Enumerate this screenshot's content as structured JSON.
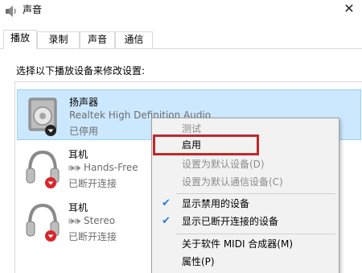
{
  "window": {
    "title": "声音",
    "close_label": "✕"
  },
  "tabs": [
    {
      "label": "播放"
    },
    {
      "label": "录制"
    },
    {
      "label": "声音"
    },
    {
      "label": "通信"
    }
  ],
  "prompt": "选择以下播放设备来修改设置:",
  "devices": [
    {
      "name": "扬声器",
      "description": "Realtek High Definition Audio",
      "status": "已停用",
      "icon": "speaker-icon"
    },
    {
      "name": "耳机",
      "description": "Hands-Free",
      "status": "已断开连接",
      "icon": "headphones-icon"
    },
    {
      "name": "耳机",
      "description": "Stereo",
      "status": "已断开连接",
      "icon": "headphones-icon"
    }
  ],
  "context_menu": {
    "items": [
      {
        "label": "测试",
        "disabled": true
      },
      {
        "label": "启用",
        "disabled": false,
        "highlighted": true
      },
      {
        "label": "设置为默认设备(D)",
        "disabled": true
      },
      {
        "label": "设置为默认通信设备(C)",
        "disabled": true
      },
      {
        "label": "显示禁用的设备",
        "checked": true
      },
      {
        "label": "显示已断开连接的设备",
        "checked": true
      },
      {
        "label": "关于软件 MIDI 合成器(M)"
      },
      {
        "label": "属性(P)"
      }
    ],
    "check_glyph": "✔"
  },
  "colors": {
    "selected_row": "#cce8ff",
    "highlight_box": "#c0282d",
    "check": "#2b7ad6",
    "disabled_badge": "#222222",
    "disconnected_badge": "#d9262b"
  }
}
